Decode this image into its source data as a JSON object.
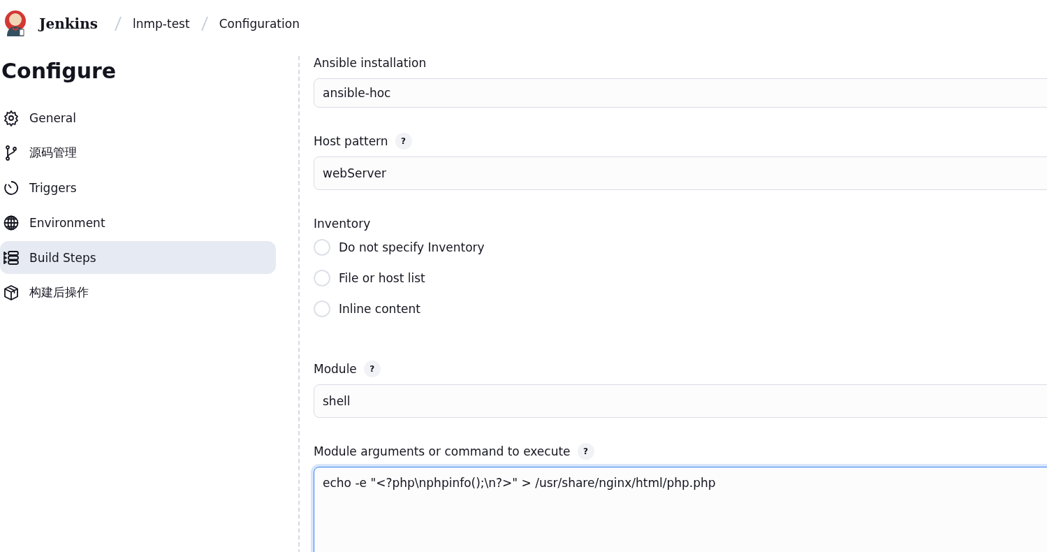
{
  "breadcrumb": [
    {
      "label": "Jenkins",
      "kind": "logo"
    },
    {
      "label": "lnmp-test",
      "kind": "link"
    },
    {
      "label": "Configuration",
      "kind": "link"
    }
  ],
  "sidebar": {
    "title": "Configure",
    "items": [
      {
        "label": "General",
        "selected": false
      },
      {
        "label": "源码管理",
        "selected": false
      },
      {
        "label": "Triggers",
        "selected": false
      },
      {
        "label": "Environment",
        "selected": false
      },
      {
        "label": "Build Steps",
        "selected": true
      },
      {
        "label": "构建后操作",
        "selected": false
      }
    ]
  },
  "form": [
    {
      "kind": "text",
      "label": "Ansible installation",
      "value": "ansible-hoc"
    },
    {
      "kind": "text",
      "label": "Host pattern",
      "help": "?",
      "value": "webServer"
    },
    {
      "kind": "radio",
      "label": "Inventory",
      "options": [
        {
          "label": "Do not specify Inventory",
          "selected": false
        },
        {
          "label": "File or host list",
          "selected": false
        },
        {
          "label": "Inline content",
          "selected": false
        }
      ]
    },
    {
      "kind": "text",
      "label": "Module",
      "help": "?",
      "value": "shell"
    },
    {
      "kind": "textarea",
      "label": "Module arguments or command to execute",
      "help": "?",
      "value": "echo -e \"<?php\\nphpinfo();\\n?>\" > /usr/share/nginx/html/php.php",
      "focused": true
    }
  ]
}
